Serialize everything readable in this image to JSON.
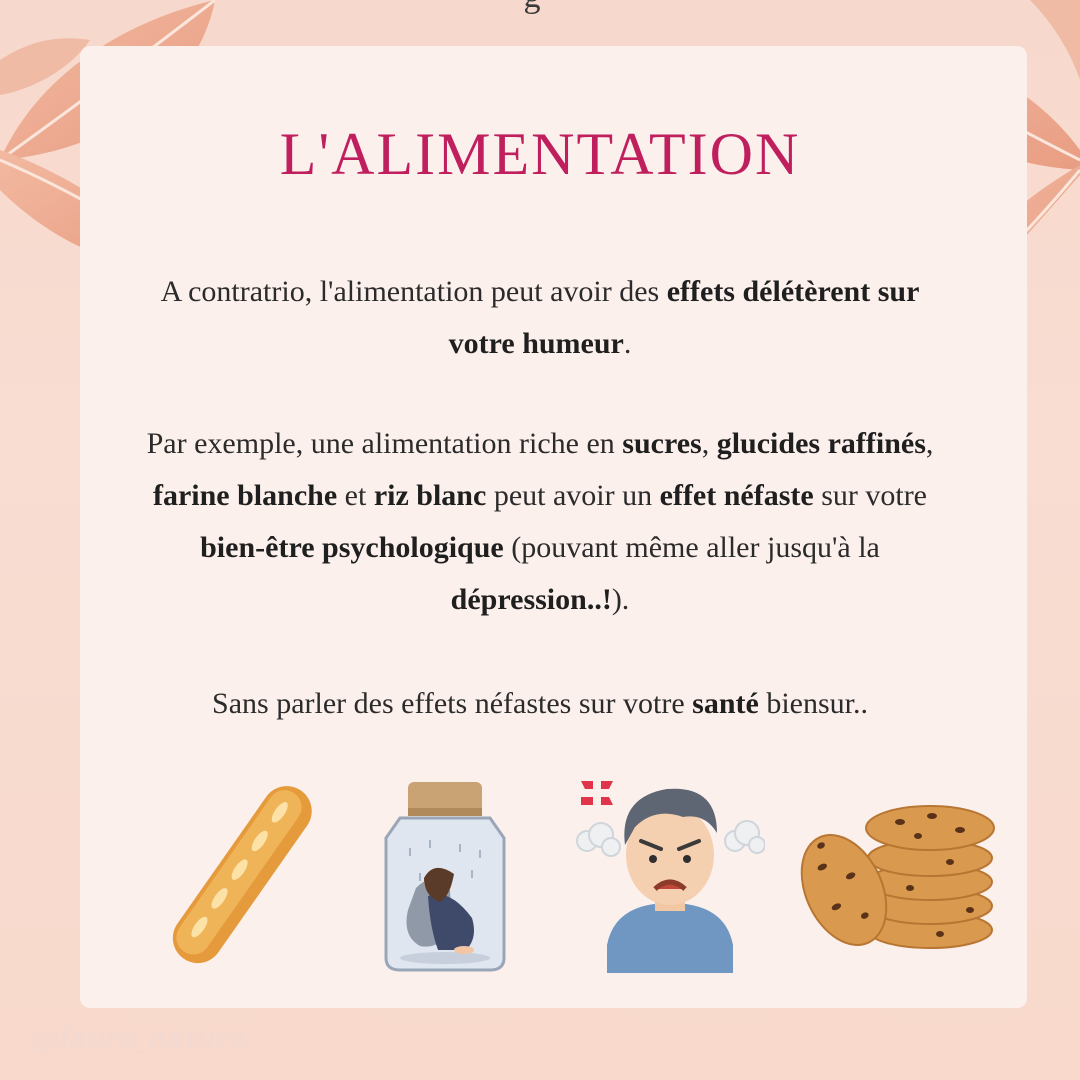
{
  "header_fragment": "g",
  "title": "L'ALIMENTATION",
  "paragraph_1": [
    {
      "text": "A contratrio, l'alimentation peut avoir des ",
      "bold": false
    },
    {
      "text": "effets",
      "bold": true
    },
    {
      "text": " ",
      "bold": false
    },
    {
      "text": "délétèrent sur votre humeur",
      "bold": true
    },
    {
      "text": ".",
      "bold": false
    }
  ],
  "paragraph_2": [
    {
      "text": "Par exemple, une alimentation riche en ",
      "bold": false
    },
    {
      "text": "sucres",
      "bold": true
    },
    {
      "text": ", ",
      "bold": false
    },
    {
      "text": "glucides raffinés",
      "bold": true
    },
    {
      "text": ", ",
      "bold": false
    },
    {
      "text": "farine blanche",
      "bold": true
    },
    {
      "text": " et ",
      "bold": false
    },
    {
      "text": "riz blanc",
      "bold": true
    },
    {
      "text": " peut avoir un ",
      "bold": false
    },
    {
      "text": "effet néfaste",
      "bold": true
    },
    {
      "text": " sur votre ",
      "bold": false
    },
    {
      "text": "bien-être psychologique",
      "bold": true
    },
    {
      "text": " (pouvant même aller jusqu'à la ",
      "bold": false
    },
    {
      "text": "dépression..!",
      "bold": true
    },
    {
      "text": ").",
      "bold": false
    }
  ],
  "paragraph_3": [
    {
      "text": "Sans parler des effets néfastes sur votre ",
      "bold": false
    },
    {
      "text": "santé",
      "bold": true
    },
    {
      "text": " biensur..",
      "bold": false
    }
  ],
  "illustrations": [
    "baguette-illustration",
    "sad-person-in-jar-illustration",
    "angry-man-illustration",
    "cookies-illustration"
  ],
  "handle": "@laure_naturo",
  "colors": {
    "title": "#c01f5e",
    "background": "#f8dbcf",
    "card": "#fcf0ed",
    "leaf": "#eca98d"
  }
}
